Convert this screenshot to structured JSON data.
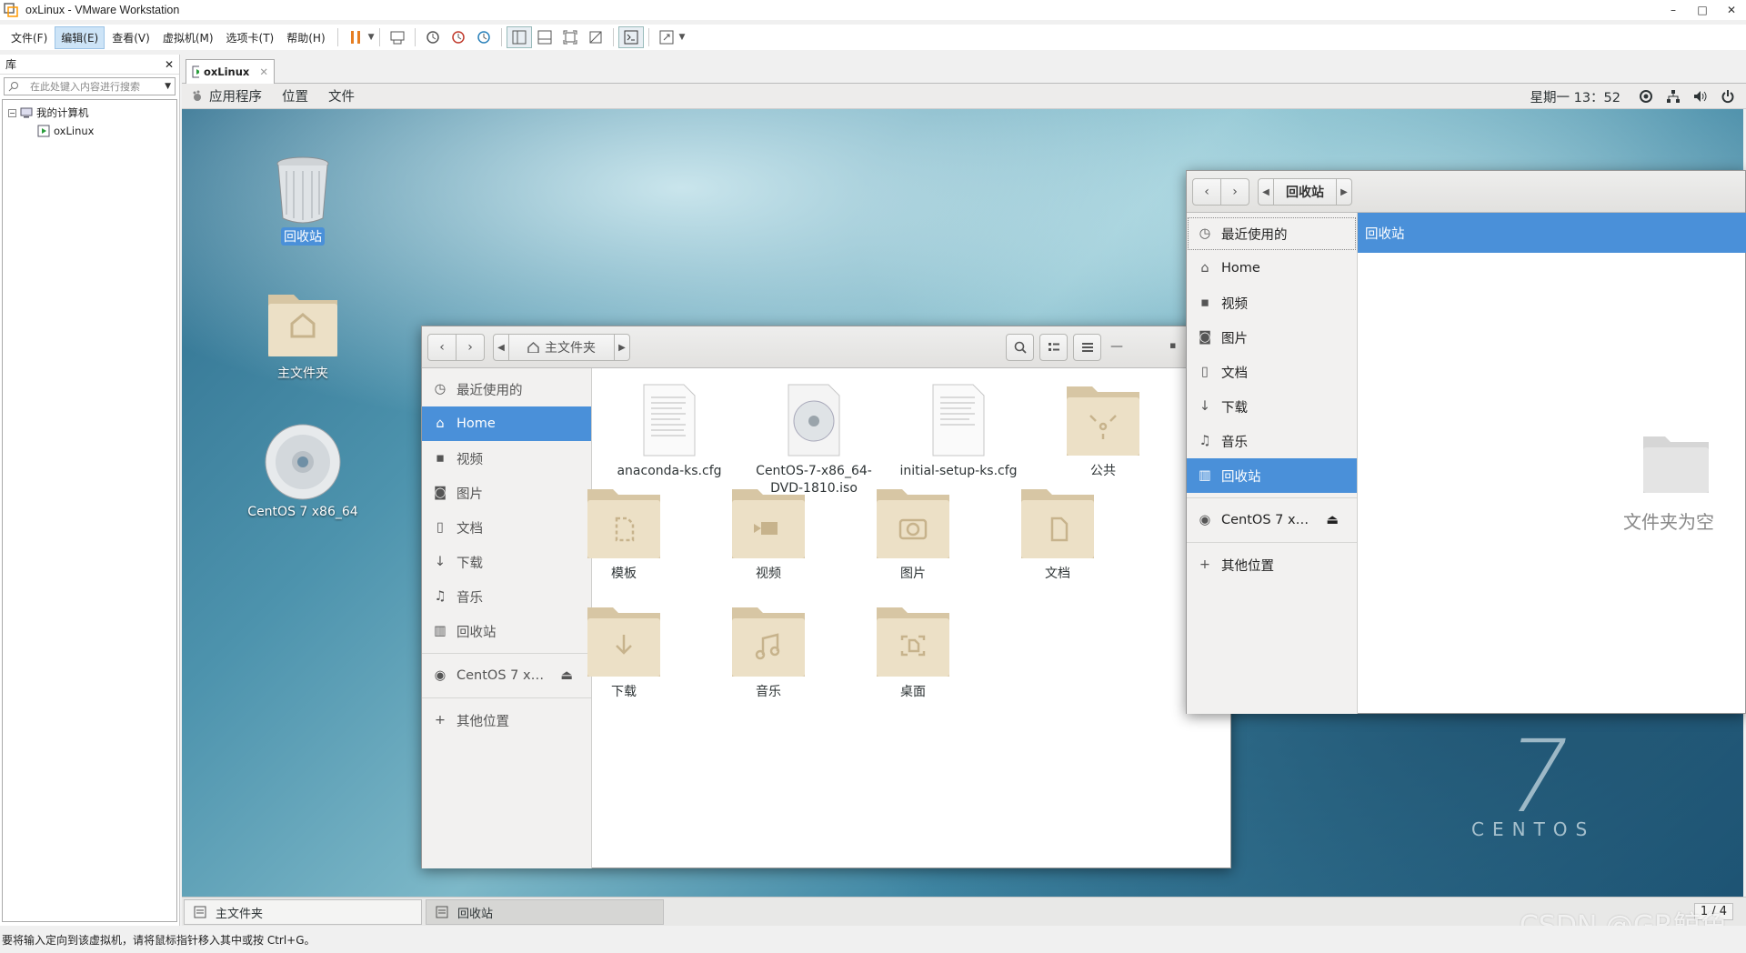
{
  "window": {
    "title": "oxLinux - VMware Workstation",
    "minimize": "–",
    "maximize": "□",
    "close": "✕"
  },
  "menu": [
    "文件(F)",
    "编辑(E)",
    "查看(V)",
    "虚拟机(M)",
    "选项卡(T)",
    "帮助(H)"
  ],
  "library": {
    "title": "库",
    "close": "✕",
    "search_placeholder": "在此处键入内容进行搜索",
    "tree": {
      "root": "我的计算机",
      "vm": "oxLinux"
    }
  },
  "vm_tab": {
    "label": "oxLinux"
  },
  "gnome": {
    "menu": [
      "应用程序",
      "位置",
      "文件"
    ],
    "clock": "星期一 13：52"
  },
  "desktop": {
    "icons": [
      {
        "label": "回收站"
      },
      {
        "label": "主文件夹"
      },
      {
        "label": "CentOS 7 x86_64"
      }
    ],
    "brand": "CENTOS",
    "brand_num": "7"
  },
  "home_window": {
    "path": "主文件夹",
    "sidebar": [
      "最近使用的",
      "Home",
      "视频",
      "图片",
      "文档",
      "下载",
      "音乐",
      "回收站",
      "CentOS 7 x…",
      "其他位置"
    ],
    "files": [
      "anaconda-ks.cfg",
      "CentOS-7-x86_64-DVD-1810.iso",
      "initial-setup-ks.cfg",
      "公共",
      "模板",
      "视频",
      "图片",
      "文档",
      "下载",
      "音乐",
      "桌面"
    ]
  },
  "trash_window": {
    "path": "回收站",
    "sidebar": [
      "最近使用的",
      "Home",
      "视频",
      "图片",
      "文档",
      "下载",
      "音乐",
      "回收站",
      "CentOS 7 x…",
      "其他位置"
    ],
    "header": "回收站",
    "empty": "文件夹为空"
  },
  "taskbar": {
    "items": [
      "主文件夹",
      "回收站"
    ],
    "pager": "1 / 4"
  },
  "status": "要将输入定向到该虚拟机，请将鼠标指针移入其中或按 Ctrl+G。",
  "watermark": "CSDN @GR鲸鱼"
}
